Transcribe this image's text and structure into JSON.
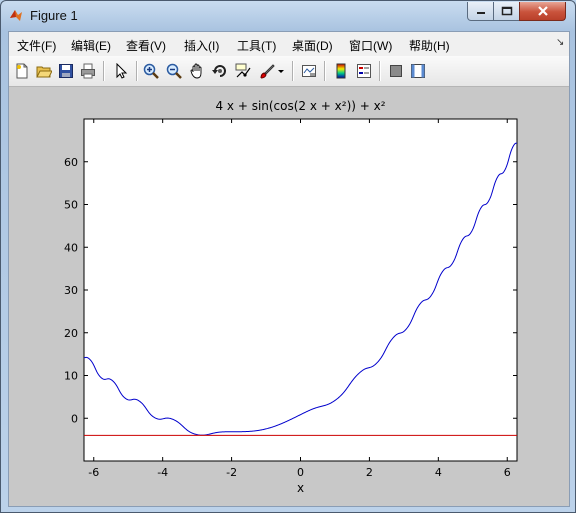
{
  "window": {
    "title": "Figure 1"
  },
  "menu": {
    "items": [
      "文件(F)",
      "编辑(E)",
      "查看(V)",
      "插入(I)",
      "工具(T)",
      "桌面(D)",
      "窗口(W)",
      "帮助(H)"
    ]
  },
  "toolbar": {
    "icons": [
      "new-figure-icon",
      "open-file-icon",
      "save-icon",
      "print-icon",
      "edit-plot-arrow-icon",
      "zoom-in-icon",
      "zoom-out-icon",
      "pan-hand-icon",
      "rotate-3d-icon",
      "data-cursor-icon",
      "brush-icon",
      "brush-dropdown-icon",
      "link-plot-icon",
      "colorbar-icon",
      "legend-icon",
      "hide-plot-tools-icon",
      "show-plot-tools-icon"
    ]
  },
  "colors": {
    "curve": "#0000cc",
    "hline": "#cc0000",
    "figure_bg": "#c8c8c8",
    "axes_bg": "#ffffff"
  },
  "chart_data": {
    "type": "line",
    "title": "4 x + sin(cos(2 x + x²)) + x²",
    "xlabel": "x",
    "ylabel": "",
    "xlim": [
      -6.2832,
      6.2832
    ],
    "ylim": [
      -10,
      70
    ],
    "xticks": [
      -6,
      -4,
      -2,
      0,
      2,
      4,
      6
    ],
    "yticks": [
      0,
      10,
      20,
      30,
      40,
      50,
      60
    ],
    "grid": false,
    "series": [
      {
        "function": "4*x + sin(cos(2*x + x^2)) + x^2",
        "x": [
          -6.28,
          -6.0,
          -5.5,
          -5.0,
          -4.5,
          -4.0,
          -3.5,
          -3.0,
          -2.5,
          -2.0,
          -1.5,
          -1.0,
          -0.5,
          0.0,
          0.5,
          1.0,
          1.5,
          2.0,
          2.5,
          3.0,
          3.5,
          4.0,
          4.5,
          5.0,
          5.5,
          6.0,
          6.28
        ],
        "values": [
          13.3,
          12.5,
          9.4,
          4.2,
          3.1,
          0.0,
          -1.3,
          -3.0,
          -3.0,
          -3.6,
          -3.7,
          -3.0,
          -2.7,
          0.8,
          2.9,
          4.3,
          9.0,
          12.4,
          16.2,
          21.8,
          26.7,
          32.8,
          38.4,
          44.5,
          51.0,
          58.8,
          64.2
        ]
      }
    ],
    "hline": {
      "y": -4
    }
  }
}
